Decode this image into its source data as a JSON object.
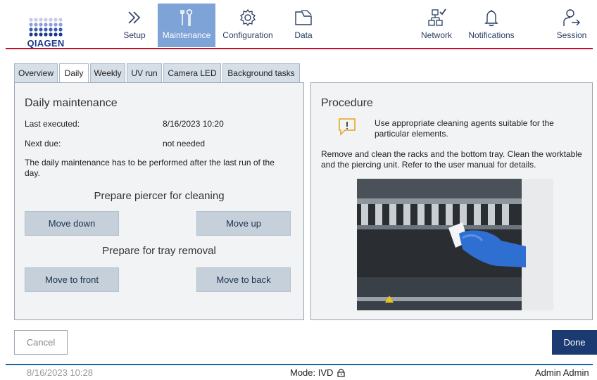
{
  "brand": {
    "logo_text": "QIAGEN",
    "accent": "#c8102e",
    "nav_active_bg": "#7ea3d6",
    "primary_button": "#1c3a72"
  },
  "nav": {
    "setup": {
      "label": "Setup",
      "icon": "double-chevron-right-icon"
    },
    "maintenance": {
      "label": "Maintenance",
      "icon": "tools-icon",
      "active": true
    },
    "configuration": {
      "label": "Configuration",
      "icon": "gear-icon"
    },
    "data": {
      "label": "Data",
      "icon": "folder-icon"
    },
    "network": {
      "label": "Network",
      "icon": "network-check-icon"
    },
    "notifications": {
      "label": "Notifications",
      "icon": "bell-icon"
    },
    "session": {
      "label": "Session",
      "icon": "user-logout-icon"
    }
  },
  "tabs": [
    {
      "label": "Overview"
    },
    {
      "label": "Daily",
      "active": true
    },
    {
      "label": "Weekly"
    },
    {
      "label": "UV run"
    },
    {
      "label": "Camera LED"
    },
    {
      "label": "Background tasks"
    }
  ],
  "daily": {
    "title": "Daily maintenance",
    "last_executed_label": "Last executed:",
    "last_executed_value": "8/16/2023 10:20",
    "next_due_label": "Next due:",
    "next_due_value": "not needed",
    "note": "The daily maintenance has to be performed after the last run of the day.",
    "piercer_heading": "Prepare piercer for cleaning",
    "move_down": "Move down",
    "move_up": "Move up",
    "tray_heading": "Prepare for tray removal",
    "move_front": "Move to front",
    "move_back": "Move to back"
  },
  "procedure": {
    "title": "Procedure",
    "warning_icon": "warning-speech-icon",
    "warning_text": "Use appropriate cleaning agents suitable for the particular elements.",
    "instructions": "Remove and clean the racks and the bottom tray. Clean the worktable and the piercing unit. Refer to the user manual for details."
  },
  "footer": {
    "cancel": "Cancel",
    "done": "Done"
  },
  "statusbar": {
    "datetime": "8/16/2023 10:28",
    "mode": "Mode: IVD",
    "mode_icon": "lock-icon",
    "user": "Admin Admin"
  }
}
